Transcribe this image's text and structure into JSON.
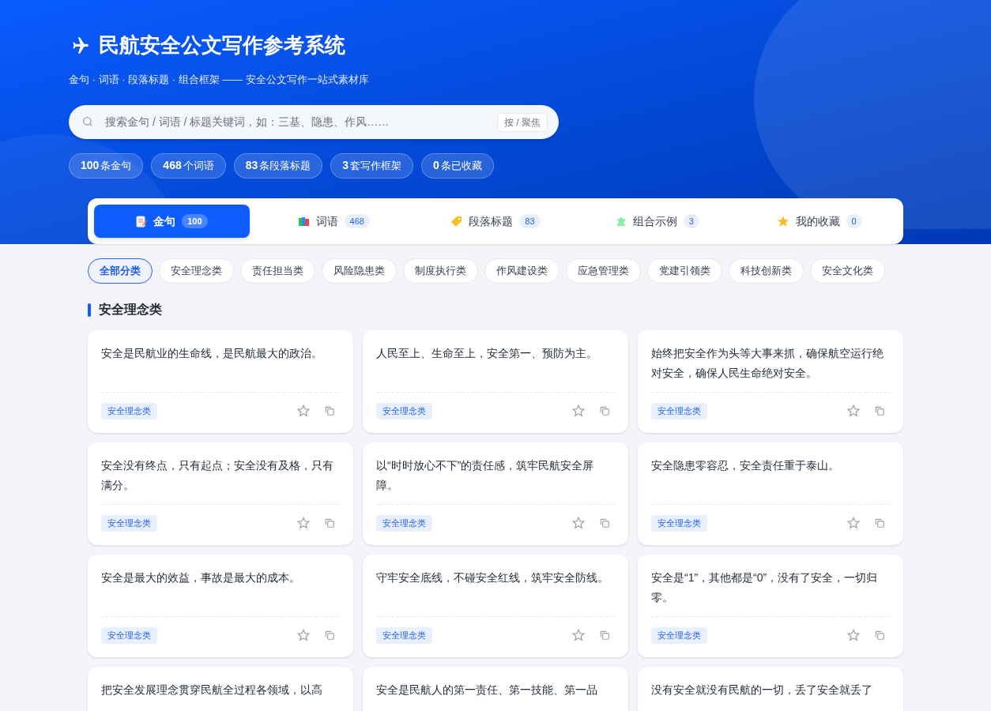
{
  "header": {
    "title": "民航安全公文写作参考系统",
    "subtitle": "金句 · 词语 · 段落标题 · 组合框架 —— 安全公文写作一站式素材库",
    "search": {
      "placeholder": "搜索金句 / 词语 / 标题关键词，如：三基、隐患、作风……",
      "shortcut": "按 / 聚焦"
    },
    "stats": [
      {
        "value": "100",
        "label": "条金句"
      },
      {
        "value": "468",
        "label": "个词语"
      },
      {
        "value": "83",
        "label": "条段落标题"
      },
      {
        "value": "3",
        "label": "套写作框架"
      },
      {
        "value": "0",
        "label": "条已收藏"
      }
    ]
  },
  "tabs": [
    {
      "kind": "memo",
      "label": "金句",
      "count": "100",
      "selected": true
    },
    {
      "kind": "books",
      "label": "词语",
      "count": "468",
      "selected": false
    },
    {
      "kind": "tag",
      "label": "段落标题",
      "count": "83",
      "selected": false
    },
    {
      "kind": "puzzle",
      "label": "组合示例",
      "count": "3",
      "selected": false
    },
    {
      "kind": "star",
      "label": "我的收藏",
      "count": "0",
      "selected": false
    }
  ],
  "categories": [
    {
      "label": "全部分类",
      "selected": true
    },
    {
      "label": "安全理念类",
      "selected": false
    },
    {
      "label": "责任担当类",
      "selected": false
    },
    {
      "label": "风险隐患类",
      "selected": false
    },
    {
      "label": "制度执行类",
      "selected": false
    },
    {
      "label": "作风建设类",
      "selected": false
    },
    {
      "label": "应急管理类",
      "selected": false
    },
    {
      "label": "党建引领类",
      "selected": false
    },
    {
      "label": "科技创新类",
      "selected": false
    },
    {
      "label": "安全文化类",
      "selected": false
    }
  ],
  "section": {
    "title": "安全理念类"
  },
  "cards": [
    {
      "text": "安全是民航业的生命线，是民航最大的政治。",
      "tag": "安全理念类",
      "starred": false
    },
    {
      "text": "人民至上、生命至上，安全第一、预防为主。",
      "tag": "安全理念类",
      "starred": false
    },
    {
      "text": "始终把安全作为头等大事来抓，确保航空运行绝对安全，确保人民生命绝对安全。",
      "tag": "安全理念类",
      "starred": false
    },
    {
      "text": "安全没有终点，只有起点；安全没有及格，只有满分。",
      "tag": "安全理念类",
      "starred": false
    },
    {
      "text": "以“时时放心不下”的责任感，筑牢民航安全屏障。",
      "tag": "安全理念类",
      "starred": false
    },
    {
      "text": "安全隐患零容忍，安全责任重于泰山。",
      "tag": "安全理念类",
      "starred": false
    },
    {
      "text": "安全是最大的效益，事故是最大的成本。",
      "tag": "安全理念类",
      "starred": false
    },
    {
      "text": "守牢安全底线，不碰安全红线，筑牢安全防线。",
      "tag": "安全理念类",
      "starred": false
    },
    {
      "text": "安全是“1”，其他都是“0”，没有了安全，一切归零。",
      "tag": "安全理念类",
      "starred": false
    },
    {
      "text": "把安全发展理念贯穿民航全过程各领域，以高"
    },
    {
      "text": "安全是民航人的第一责任、第一技能、第一品"
    },
    {
      "text": "没有安全就没有民航的一切，丢了安全就丢了"
    }
  ]
}
